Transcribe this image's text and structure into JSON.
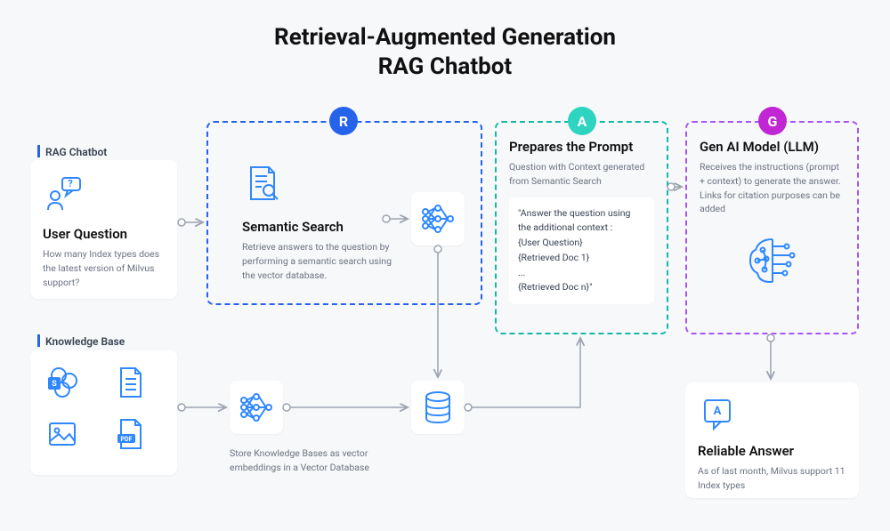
{
  "title_line1": "Retrieval-Augmented Generation",
  "title_line2": "RAG Chatbot",
  "sections": {
    "rag_chatbot": "RAG Chatbot",
    "knowledge_base": "Knowledge Base"
  },
  "badges": {
    "r": "R",
    "a": "A",
    "g": "G"
  },
  "user_question": {
    "title": "User Question",
    "desc": "How many Index types does the latest version of Milvus support?"
  },
  "semantic_search": {
    "title": "Semantic Search",
    "desc": "Retrieve answers to the question by performing a semantic search using the vector database."
  },
  "prepares_prompt": {
    "title": "Prepares the Prompt",
    "desc": "Question with Context generated from Semantic Search",
    "template_l1": "\"Answer the question using the additional context :",
    "template_l2": "{User Question}",
    "template_l3": "{Retrieved Doc 1}",
    "template_l4": "...",
    "template_l5": "{Retrieved Doc n}\""
  },
  "gen_ai": {
    "title": "Gen AI Model (LLM)",
    "desc": "Receives the instructions (prompt + context) to generate the answer. Links for citation purposes can be added"
  },
  "reliable_answer": {
    "title": "Reliable Answer",
    "desc": "As of last month, Milvus support 11 Index types"
  },
  "store_kb": "Store Knowledge Bases as vector embeddings in a Vector Database"
}
